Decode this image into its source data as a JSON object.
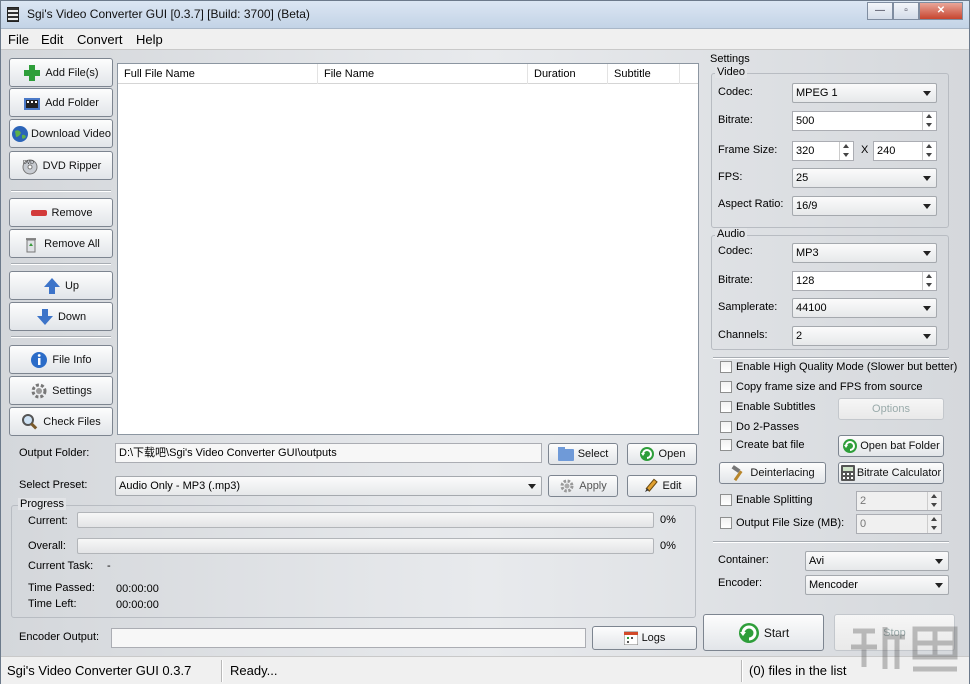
{
  "window": {
    "title": "Sgi's Video Converter GUI [0.3.7] [Build: 3700] (Beta)",
    "controls": {
      "minimize": "—",
      "maximize": "▫",
      "close": "✕"
    }
  },
  "menu": [
    "File",
    "Edit",
    "Convert",
    "Help"
  ],
  "sidebar": {
    "add_files": "Add File(s)",
    "add_folder": "Add Folder",
    "download_video": "Download Video",
    "dvd_ripper": "DVD Ripper",
    "remove": "Remove",
    "remove_all": "Remove All",
    "up": "Up",
    "down": "Down",
    "file_info": "File Info",
    "settings": "Settings",
    "check_files": "Check Files"
  },
  "file_list": {
    "columns": [
      "Full File Name",
      "File Name",
      "Duration",
      "Subtitle"
    ],
    "rows": []
  },
  "output_folder": {
    "label": "Output Folder:",
    "value": "D:\\下载吧\\Sgi's Video Converter GUI\\outputs",
    "select": "Select",
    "open": "Open"
  },
  "preset": {
    "label": "Select Preset:",
    "value": "Audio Only - MP3 (.mp3)",
    "apply": "Apply",
    "edit": "Edit"
  },
  "progress": {
    "title": "Progress",
    "current_label": "Current:",
    "current_value": 0,
    "current_pct": "0%",
    "overall_label": "Overall:",
    "overall_value": 0,
    "overall_pct": "0%",
    "task_label": "Current Task:",
    "task_value": "-",
    "passed_label": "Time Passed:",
    "passed_value": "00:00:00",
    "left_label": "Time Left:",
    "left_value": "00:00:00"
  },
  "encoder_output": {
    "label": "Encoder Output:",
    "value": "",
    "logs": "Logs"
  },
  "settings": {
    "title": "Settings",
    "video": {
      "title": "Video",
      "codec_label": "Codec:",
      "codec": "MPEG 1",
      "bitrate_label": "Bitrate:",
      "bitrate": "500",
      "frame_label": "Frame Size:",
      "width": "320",
      "x": "X",
      "height": "240",
      "fps_label": "FPS:",
      "fps": "25",
      "aspect_label": "Aspect Ratio:",
      "aspect": "16/9"
    },
    "audio": {
      "title": "Audio",
      "codec_label": "Codec:",
      "codec": "MP3",
      "bitrate_label": "Bitrate:",
      "bitrate": "128",
      "samplerate_label": "Samplerate:",
      "samplerate": "44100",
      "channels_label": "Channels:",
      "channels": "2"
    },
    "options": {
      "high_quality": "Enable High Quality Mode (Slower but better)",
      "copy_frame": "Copy frame size and FPS from source",
      "subtitles": "Enable Subtitles",
      "options_btn": "Options",
      "two_pass": "Do 2-Passes",
      "bat_file": "Create bat file",
      "open_bat": "Open bat Folder",
      "deinterlacing": "Deinterlacing",
      "bitrate_calc": "Bitrate Calculator",
      "splitting": "Enable Splitting",
      "split_value": "2",
      "file_size": "Output File Size (MB):",
      "size_value": "0"
    },
    "container_label": "Container:",
    "container": "Avi",
    "encoder_label": "Encoder:",
    "encoder": "Mencoder"
  },
  "actions": {
    "start": "Start",
    "stop": "Stop"
  },
  "status": {
    "app": "Sgi's Video Converter GUI 0.3.7",
    "state": "Ready...",
    "count": "(0) files in the list"
  },
  "colors": {
    "accent_green": "#2e9e3a",
    "progress_green": "#3cb043",
    "window_bg": "#dfe3e8"
  }
}
